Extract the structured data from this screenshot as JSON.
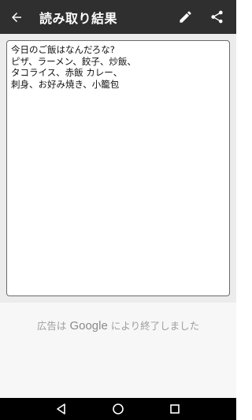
{
  "app_bar": {
    "title": "読み取り結果",
    "back_icon": "arrow-back-icon",
    "edit_icon": "pencil-icon",
    "share_icon": "share-icon",
    "background": "#2f2f2f"
  },
  "result": {
    "text": "今日のご飯はなんだろな?\nピザ、ラーメン、餃子、炒飯、\nタコライス、赤飯 カレー、\n刺身、お好み焼き、小籠包"
  },
  "ad": {
    "prefix": "広告は",
    "brand": "Google",
    "suffix": "により終了しました"
  },
  "nav": {
    "back": "nav-back-icon",
    "home": "nav-home-icon",
    "recents": "nav-recents-icon"
  }
}
